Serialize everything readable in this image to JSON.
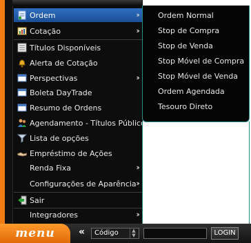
{
  "menu": {
    "items": [
      {
        "label": "Ordem",
        "icon": "order-icon",
        "submenu": true,
        "active": true
      },
      {
        "label": "Cotação",
        "icon": "chart-icon",
        "submenu": true
      },
      {
        "label": "Títulos Disponíveis",
        "icon": "list-icon"
      },
      {
        "label": "Alerta de Cotação",
        "icon": "bell-icon"
      },
      {
        "label": "Perspectivas",
        "icon": "window-icon",
        "submenu": true
      },
      {
        "label": "Boleta DayTrade",
        "icon": "window-icon"
      },
      {
        "label": "Resumo de Ordens",
        "icon": "window-icon"
      },
      {
        "label": "Agendamento - Títulos Públicos",
        "icon": "people-icon"
      },
      {
        "label": "Lista de opções",
        "icon": "filter-icon"
      },
      {
        "label": "Empréstimo de Ações",
        "icon": "handshake-icon"
      },
      {
        "label": "Renda Fixa",
        "icon": "",
        "submenu": true
      },
      {
        "label": "Configurações de Aparência",
        "icon": "",
        "submenu": true
      },
      {
        "label": "Sair",
        "icon": "exit-icon"
      },
      {
        "label": "Integradores",
        "icon": "",
        "submenu": true
      }
    ]
  },
  "submenu": {
    "items": [
      "Ordem Normal",
      "Stop de Compra",
      "Stop de Venda",
      "Stop Móvel de Compra",
      "Stop Móvel de Venda",
      "Ordem Agendada",
      "Tesouro Direto"
    ]
  },
  "bottom_bar": {
    "menu_label": "menu",
    "collapse_label": "«",
    "select_value": "Código",
    "login_label": "LOGIN"
  },
  "colors": {
    "accent_orange": "#f07c14",
    "active_blue": "#2f6fc0",
    "submenu_border": "#2a8a8a"
  }
}
